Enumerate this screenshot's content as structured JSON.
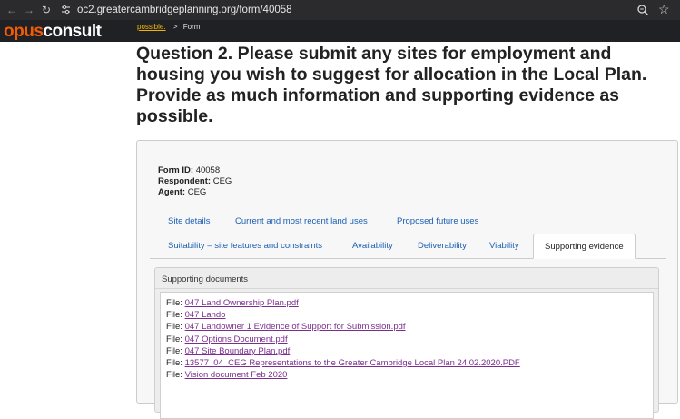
{
  "browser": {
    "url": "oc2.greatercambridgeplanning.org/form/40058",
    "icons": {
      "back": "back-arrow-icon",
      "forward": "forward-arrow-icon",
      "reload": "reload-icon",
      "site_info": "site-info-icon",
      "zoom": "zoom-icon",
      "bookmark": "bookmark-star-icon"
    }
  },
  "header": {
    "logo_part1": "opus",
    "logo_part2": "consult",
    "breadcrumb": {
      "link": "possible.",
      "sep": ">",
      "current": "Form"
    }
  },
  "page": {
    "title": "Question 2. Please submit any sites for employment and housing you wish to suggest for allocation in the Local Plan. Provide as much information and supporting evidence as possible."
  },
  "form": {
    "id_label": "Form ID:",
    "id_value": "40058",
    "respondent_label": "Respondent:",
    "respondent_value": "CEG",
    "agent_label": "Agent:",
    "agent_value": "CEG"
  },
  "tabs": {
    "site_details": "Site details",
    "land_uses": "Current and most recent land uses",
    "future_uses": "Proposed future uses",
    "suitability": "Suitability – site features and constraints",
    "availability": "Availability",
    "deliverability": "Deliverability",
    "viability": "Viability",
    "supporting_evidence": "Supporting evidence",
    "active": "Supporting evidence"
  },
  "supporting_docs": {
    "heading": "Supporting documents",
    "file_label": "File:",
    "files": [
      "047 Land Ownership Plan.pdf",
      "047 Lando",
      "047 Landowner 1 Evidence of Support for Submission.pdf",
      "047 Options Document.pdf",
      "047 Site Boundary Plan.pdf",
      "13577_04_CEG Representations to the Greater Cambridge Local Plan 24.02.2020.PDF",
      "Vision document Feb 2020"
    ]
  },
  "colors": {
    "chrome_bg": "#2b2b2e",
    "header_bg": "#202124",
    "logo_accent": "#f25c05",
    "breadcrumb_link": "#f2b400",
    "tab_link": "#1a5fb4",
    "file_link": "#7b2e8e"
  }
}
